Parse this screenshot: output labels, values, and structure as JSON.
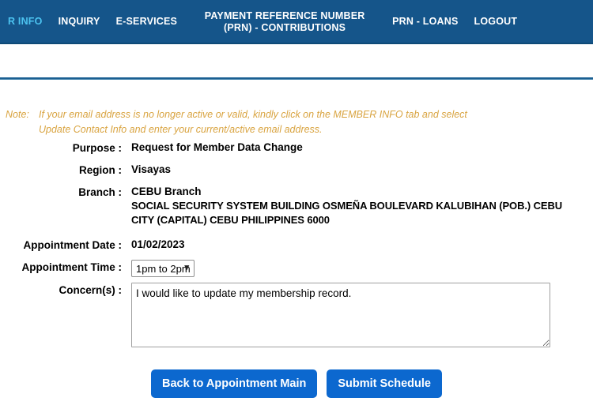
{
  "nav": {
    "items": [
      {
        "label": "R INFO",
        "active": true,
        "wrap": false
      },
      {
        "label": "INQUIRY",
        "active": false,
        "wrap": false
      },
      {
        "label": "E-SERVICES",
        "active": false,
        "wrap": false
      },
      {
        "label": "PAYMENT REFERENCE NUMBER (PRN) - CONTRIBUTIONS",
        "active": false,
        "wrap": true
      },
      {
        "label": "PRN - LOANS",
        "active": false,
        "wrap": false
      },
      {
        "label": "LOGOUT",
        "active": false,
        "wrap": false
      }
    ],
    "bg_color": "#15558a",
    "active_color": "#4cc3f0"
  },
  "note": {
    "label": "Note:",
    "text": "If your email address is no longer active or valid, kindly click on the MEMBER INFO tab and select Update Contact Info and enter your current/active email address.",
    "color": "#d9a441"
  },
  "form": {
    "purpose_label": "Purpose :",
    "purpose_value": "Request for Member Data Change",
    "region_label": "Region :",
    "region_value": "Visayas",
    "branch_label": "Branch :",
    "branch_value": "CEBU Branch",
    "branch_address": "SOCIAL SECURITY SYSTEM BUILDING OSMEÑA BOULEVARD KALUBIHAN (POB.) CEBU CITY (CAPITAL) CEBU PHILIPPINES 6000",
    "date_label": "Appointment Date :",
    "date_value": "01/02/2023",
    "time_label": "Appointment Time :",
    "time_value": "1pm to 2pm",
    "time_options": [
      "1pm to 2pm"
    ],
    "concern_label": "Concern(s) :",
    "concern_value": "I would like to update my membership record."
  },
  "buttons": {
    "back_label": "Back to Appointment Main",
    "submit_label": "Submit Schedule",
    "color": "#0c68cf"
  }
}
